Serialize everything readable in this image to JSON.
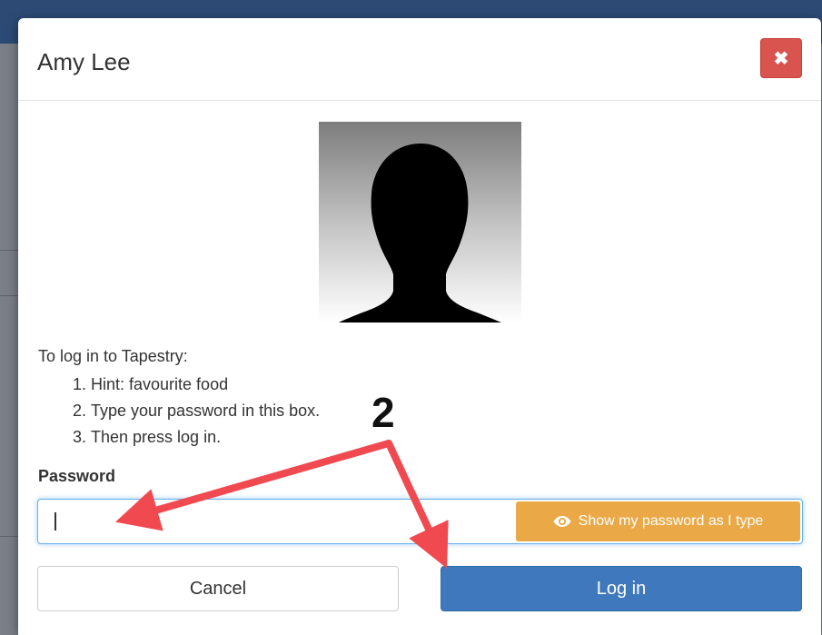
{
  "modal": {
    "title": "Amy Lee",
    "close_icon": "close-icon"
  },
  "avatar": {
    "icon": "person-silhouette-icon"
  },
  "instructions": {
    "heading": "To log in to Tapestry:",
    "steps": [
      "Hint: favourite food",
      "Type your password in this box.",
      "Then press log in."
    ]
  },
  "password": {
    "label": "Password",
    "value": "",
    "show_button_label": "Show my password as I type",
    "show_button_icon": "eye-icon"
  },
  "buttons": {
    "cancel_label": "Cancel",
    "login_label": "Log in"
  },
  "annotation": {
    "number": "2",
    "color": "#f04a50"
  },
  "colors": {
    "danger": "#d9534f",
    "warning": "#eaa946",
    "primary": "#3f78bc"
  }
}
